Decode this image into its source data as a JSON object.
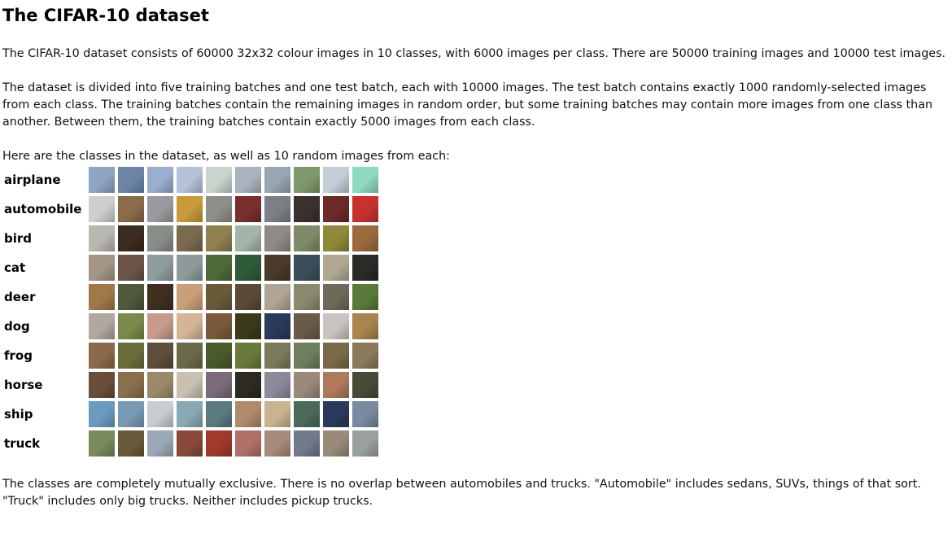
{
  "title": "The CIFAR-10 dataset",
  "paragraphs": [
    "The CIFAR-10 dataset consists of 60000 32x32 colour images in 10 classes, with 6000 images per class. There are 50000 training images and 10000 test images.",
    "The dataset is divided into five training batches and one test batch, each with 10000 images. The test batch contains exactly 1000 randomly-selected images from each class. The training batches contain the remaining images in random order, but some training batches may contain more images from one class than another. Between them, the training batches contain exactly 5000 images from each class.",
    "Here are the classes in the dataset, as well as 10 random images from each:",
    "The classes are completely mutually exclusive. There is no overlap between automobiles and trucks. \"Automobile\" includes sedans, SUVs, things of that sort. \"Truck\" includes only big trucks. Neither includes pickup trucks."
  ],
  "classes": [
    {
      "label": "airplane",
      "colors": [
        "#8fa5c4",
        "#6d86a8",
        "#9aaecd",
        "#b4c2d6",
        "#c9d4cc",
        "#aab3bd",
        "#97a6b3",
        "#7f9a6a",
        "#c4ccd8",
        "#8fd9c3"
      ]
    },
    {
      "label": "automobile",
      "colors": [
        "#cfcfcf",
        "#8a6b4a",
        "#9a9aa0",
        "#c89a3a",
        "#8e8f8a",
        "#7a2f2f",
        "#7d7f86",
        "#3a3030",
        "#6d2a28",
        "#c8322e"
      ]
    },
    {
      "label": "bird",
      "colors": [
        "#b8b8b0",
        "#3c2b1e",
        "#8a8e88",
        "#7a6a4e",
        "#8f8050",
        "#a4b4a6",
        "#8f8a84",
        "#7e8a68",
        "#8e8a3a",
        "#9a6a3e"
      ]
    },
    {
      "label": "cat",
      "colors": [
        "#a49684",
        "#6e5448",
        "#8e9c9e",
        "#8e9a9a",
        "#4e6a3a",
        "#2e5a3a",
        "#4a3a2a",
        "#3a4e5a",
        "#b0a894",
        "#2a2a26"
      ]
    },
    {
      "label": "deer",
      "colors": [
        "#a0784a",
        "#4e5a3a",
        "#3e2e1e",
        "#c8a078",
        "#6a5a3a",
        "#5a4a36",
        "#b0a494",
        "#8a8a6e",
        "#6e6a5a",
        "#5a7a3a"
      ]
    },
    {
      "label": "dog",
      "colors": [
        "#b0a8a0",
        "#7a8a4a",
        "#c89a8a",
        "#d4b494",
        "#7a5a3a",
        "#3a3a1a",
        "#2a3a5a",
        "#6a5a4a",
        "#c8c4c0",
        "#a8844e"
      ]
    },
    {
      "label": "frog",
      "colors": [
        "#8a6a4a",
        "#6a6e3a",
        "#5e4e3a",
        "#6a6a4a",
        "#4a5a2a",
        "#6a7a3a",
        "#7a7a5a",
        "#6e7e5e",
        "#7a6a4a",
        "#8a7a5a"
      ]
    },
    {
      "label": "horse",
      "colors": [
        "#6a4e3a",
        "#8a6e4e",
        "#9a8a6a",
        "#c8c0b0",
        "#7a6a7a",
        "#2e2a22",
        "#8a8a9a",
        "#9a8a7a",
        "#b07a5a",
        "#4a4a3a"
      ]
    },
    {
      "label": "ship",
      "colors": [
        "#6a9ac0",
        "#7a9ab4",
        "#c8ccd0",
        "#8aa8b4",
        "#5a7a7e",
        "#b08a6a",
        "#c8b490",
        "#4a6a5a",
        "#2a3a5a",
        "#7a8aa0"
      ]
    },
    {
      "label": "truck",
      "colors": [
        "#7a8a5a",
        "#6a5a3a",
        "#9aa8b8",
        "#8a4a3a",
        "#a03a2a",
        "#b0706a",
        "#a88a7a",
        "#707a8a",
        "#9a8a7a",
        "#9aa0a0"
      ]
    }
  ]
}
